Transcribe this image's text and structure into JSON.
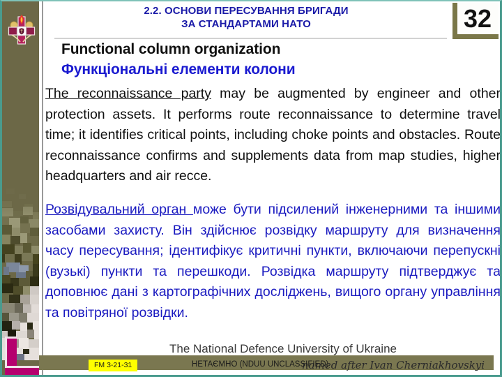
{
  "slide": {
    "number": "32",
    "header_lines": [
      "2.2. ОСНОВИ ПЕРЕСУВАННЯ БРИГАДИ",
      "ЗА СТАНДАРТАМИ  НАТО"
    ],
    "title_en": "Functional column organization",
    "title_uk": "Функціональні елементи колони"
  },
  "body": {
    "english": {
      "underlined_lead": "The reconnaissance party",
      "rest": " may be augmented by engineer and other protection assets. It performs route reconnaissance to determine travel time; it identifies critical points, including choke points and obstacles. Route reconnaissance  confirms and supplements data from map studies, higher headquarters and air recce."
    },
    "ukrainian": {
      "underlined_lead": "Розвідувальний орган ",
      "rest": "може бути підсилений інженерними та іншими засобами захисту. Він здійснює розвідку маршруту для визначення часу пересування; ідентифікує критичні пункти, включаючи перепускні (вузькі) пункти та перешкоди. Розвідка маршруту підтверджує та доповнює дані з картографічних досліджень, вищого органу управління та повітряної розвідки."
    }
  },
  "footer": {
    "university": "The National Defence University of Ukraine",
    "named_after": "named after Ivan Cherniakhovskyi",
    "fm_reference": "FM 3-21-31",
    "classification": "НЕТАЄМНО (NDUU UNCLASSIFIED)"
  },
  "colors": {
    "header_blue": "#1a1aa8",
    "body_blue": "#1a1ac0",
    "olive": "#6c6847",
    "footer_olive": "#7a7750",
    "teal_border": "#4a9b8e",
    "highlight_yellow": "#ffff00",
    "magenta": "#b5006e"
  },
  "emblem": {
    "name": "ndu-ukraine-emblem"
  }
}
